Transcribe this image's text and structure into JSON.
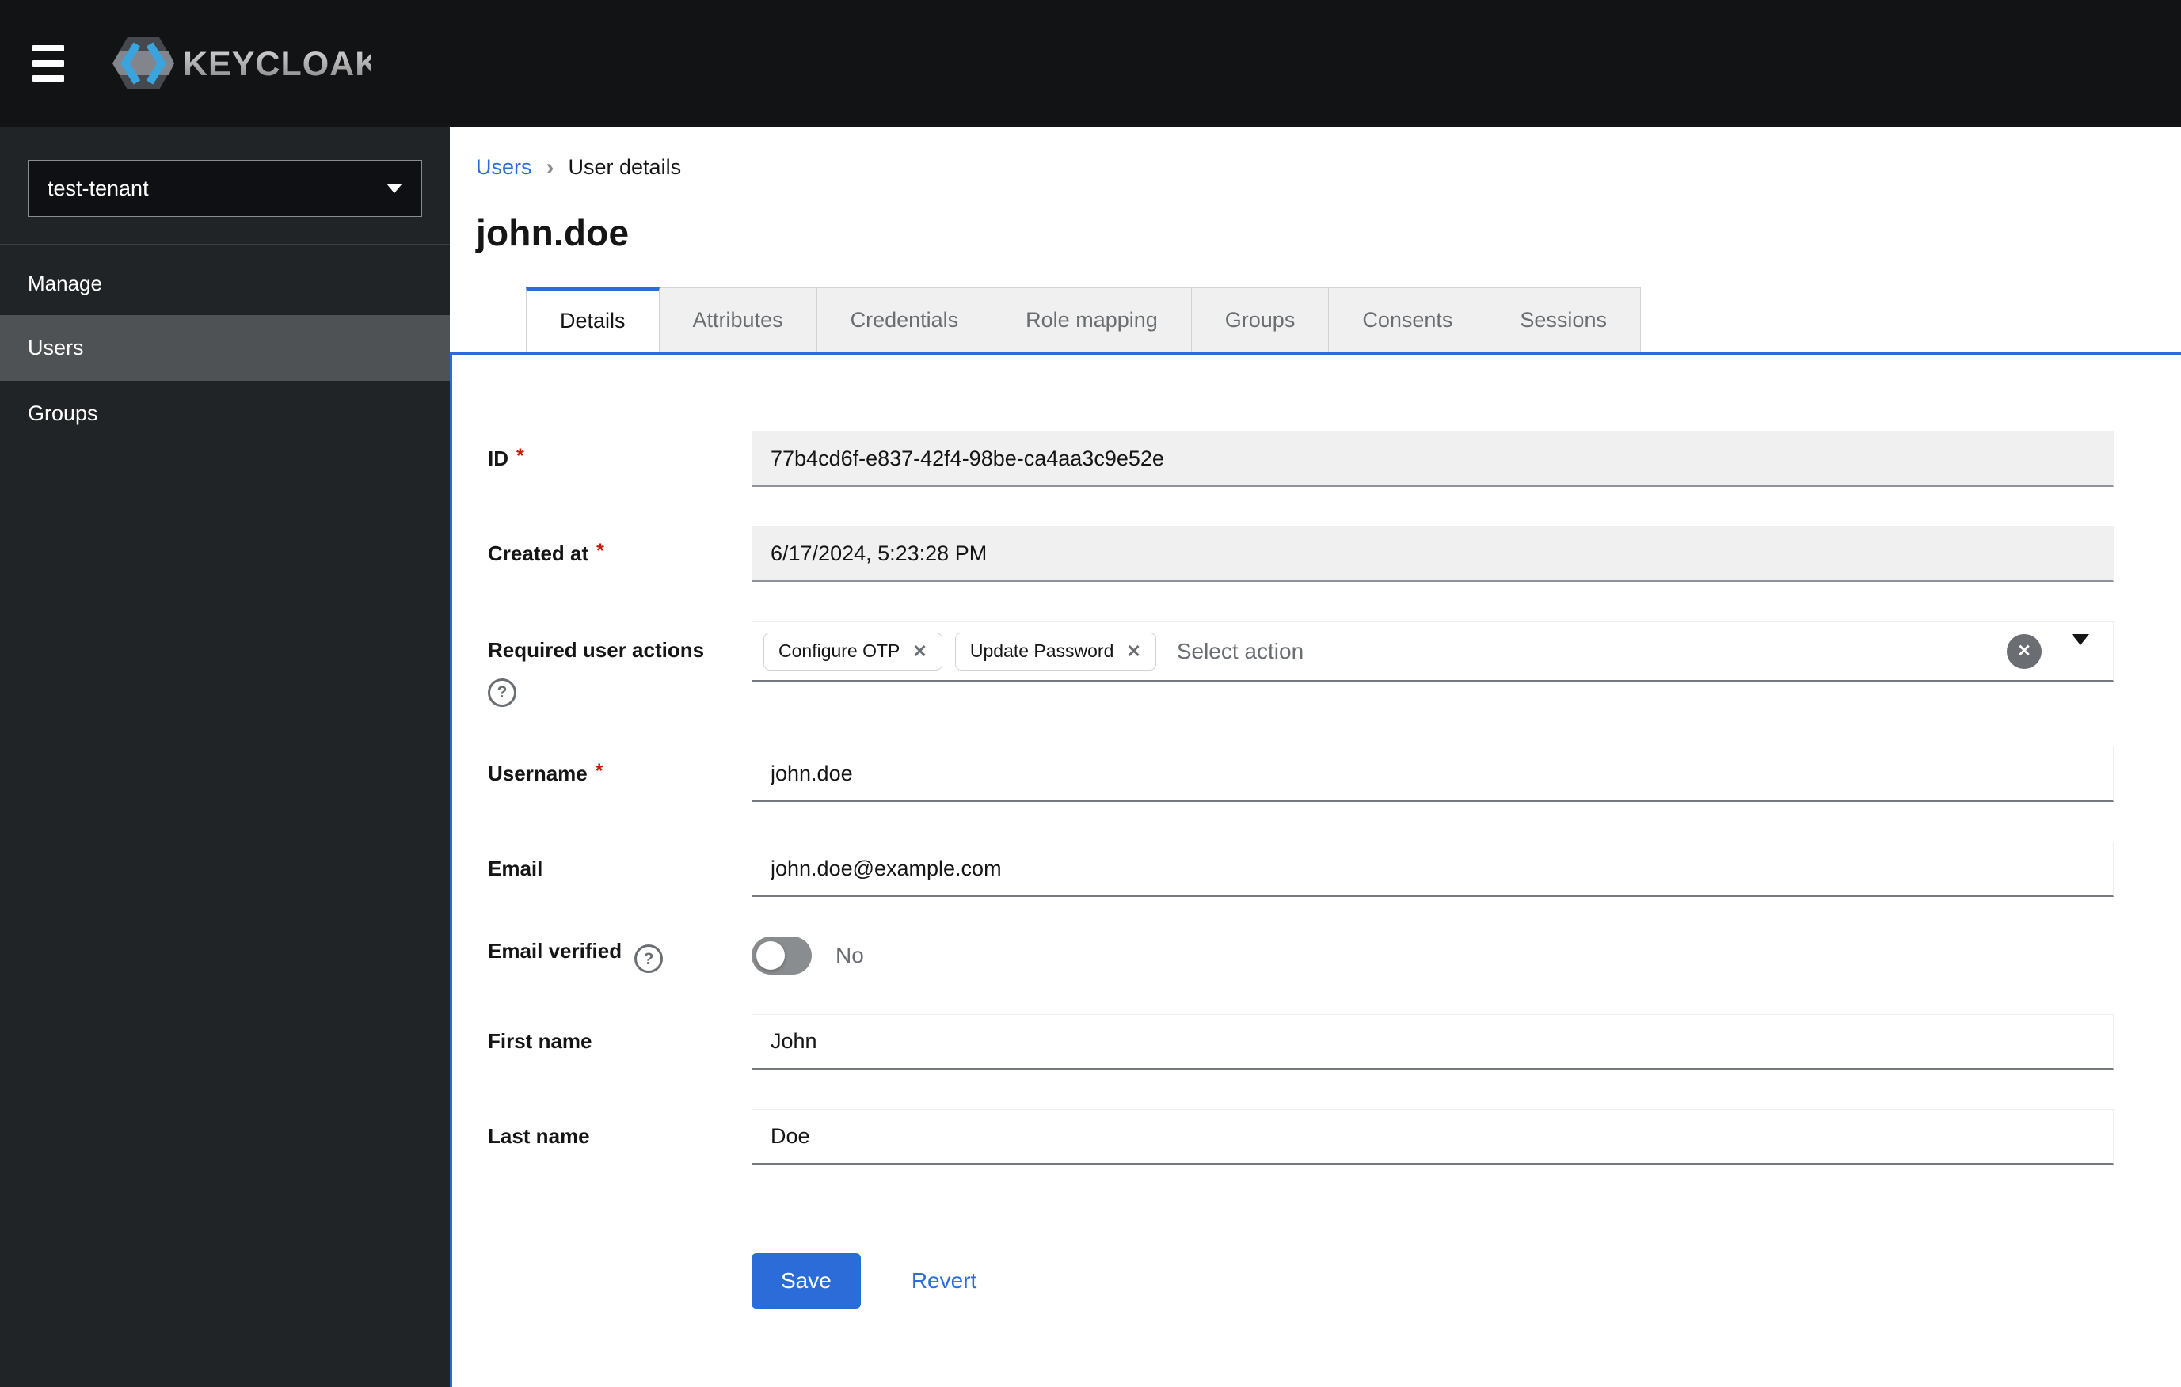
{
  "masthead": {
    "brand": "KEYCLOAK"
  },
  "sidebar": {
    "realm_selector": {
      "value": "test-tenant"
    },
    "section_label": "Manage",
    "items": [
      {
        "label": "Users",
        "active": true
      },
      {
        "label": "Groups",
        "active": false
      }
    ]
  },
  "breadcrumb": {
    "parent": "Users",
    "current": "User details"
  },
  "page": {
    "title": "john.doe"
  },
  "tabs": [
    "Details",
    "Attributes",
    "Credentials",
    "Role mapping",
    "Groups",
    "Consents",
    "Sessions"
  ],
  "active_tab": "Details",
  "form": {
    "id": {
      "label": "ID",
      "required": true,
      "disabled": true,
      "value": "77b4cd6f-e837-42f4-98be-ca4aa3c9e52e"
    },
    "created_at": {
      "label": "Created at",
      "required": true,
      "disabled": true,
      "value": "6/17/2024, 5:23:28 PM"
    },
    "required_user_actions": {
      "label": "Required user actions",
      "placeholder": "Select action",
      "chips": [
        "Configure OTP",
        "Update Password"
      ]
    },
    "username": {
      "label": "Username",
      "required": true,
      "value": "john.doe"
    },
    "email": {
      "label": "Email",
      "value": "john.doe@example.com"
    },
    "email_verified": {
      "label": "Email verified",
      "state": "No",
      "enabled": false
    },
    "first_name": {
      "label": "First name",
      "value": "John"
    },
    "last_name": {
      "label": "Last name",
      "value": "Doe"
    }
  },
  "actions": {
    "save": "Save",
    "revert": "Revert"
  },
  "icons": {
    "close": "✕",
    "help": "?",
    "breadcrumb_separator": "›"
  },
  "ui": {
    "required_marker": "*"
  },
  "colors": {
    "accent_blue": "#2b6cd9",
    "masthead_bg": "#121315",
    "sidebar_bg": "#212427",
    "sidebar_active_bg": "#4f5255",
    "disabled_input_bg": "#f0f0f0",
    "required_red": "#c9190b",
    "muted_text": "#6a6e73"
  }
}
